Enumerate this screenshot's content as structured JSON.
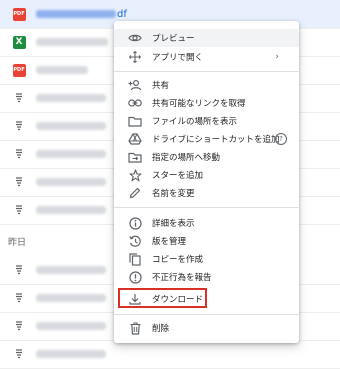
{
  "files": {
    "rows": [
      {
        "type": "pdf",
        "name_suffix": "df",
        "selected": true
      },
      {
        "type": "xls",
        "name_suffix": "",
        "selected": false
      },
      {
        "type": "pdf",
        "name_suffix": "",
        "selected": false
      },
      {
        "type": "generic",
        "name_suffix": "",
        "selected": false
      },
      {
        "type": "generic",
        "name_suffix": "",
        "selected": false
      },
      {
        "type": "generic",
        "name_suffix": "",
        "selected": false
      },
      {
        "type": "generic",
        "name_suffix": "",
        "selected": false
      },
      {
        "type": "generic",
        "name_suffix": "",
        "selected": false
      },
      {
        "type": "generic",
        "name_suffix": "",
        "selected": false
      }
    ],
    "section_label": "昨日",
    "rows_after": [
      {
        "type": "generic"
      },
      {
        "type": "generic"
      },
      {
        "type": "generic"
      },
      {
        "type": "generic"
      }
    ],
    "pdf_icon_text": "PDF",
    "xls_icon_text": "X"
  },
  "menu": {
    "items": [
      {
        "icon": "eye-icon",
        "label": "プレビュー",
        "active": true
      },
      {
        "icon": "move-arrows-icon",
        "label": "アプリで開く",
        "submenu": true
      },
      {
        "icon": "add-person-icon",
        "label": "共有"
      },
      {
        "icon": "link-icon",
        "label": "共有可能なリンクを取得"
      },
      {
        "icon": "folder-icon",
        "label": "ファイルの場所を表示"
      },
      {
        "icon": "drive-shortcut-icon",
        "label": "ドライブにショートカットを追加",
        "help": true
      },
      {
        "icon": "folder-move-icon",
        "label": "指定の場所へ移動"
      },
      {
        "icon": "star-icon",
        "label": "スターを追加"
      },
      {
        "icon": "pencil-icon",
        "label": "名前を変更"
      },
      {
        "icon": "info-icon",
        "label": "詳細を表示"
      },
      {
        "icon": "versions-icon",
        "label": "版を管理"
      },
      {
        "icon": "copy-icon",
        "label": "コピーを作成"
      },
      {
        "icon": "report-icon",
        "label": "不正行為を報告"
      },
      {
        "icon": "download-icon",
        "label": "ダウンロード",
        "highlighted": true
      },
      {
        "icon": "trash-icon",
        "label": "削除"
      }
    ],
    "submenu_arrow": "›",
    "help_mark": "?"
  },
  "colors": {
    "highlight_border": "#d93025",
    "selected_row": "#e8f0fe"
  }
}
